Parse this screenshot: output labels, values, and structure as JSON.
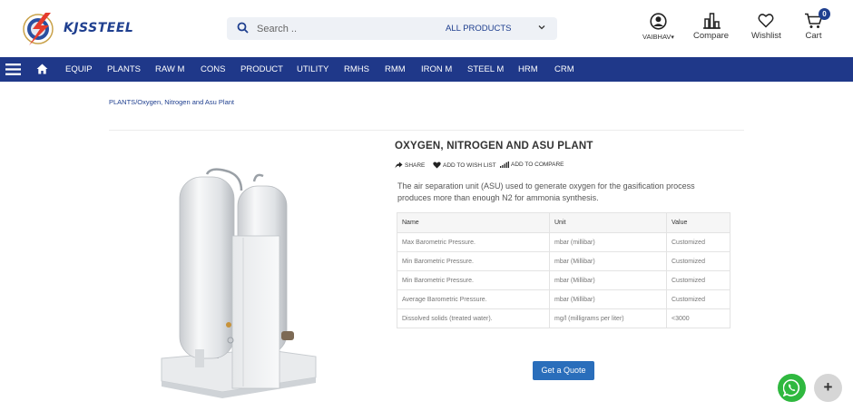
{
  "brand": {
    "name": "KJSSTEEL"
  },
  "search": {
    "placeholder": "Search ..",
    "category": "ALL PRODUCTS"
  },
  "header": {
    "user_label": "VAIBHAV",
    "compare_label": "Compare",
    "wishlist_label": "Wishlist",
    "cart_label": "Cart",
    "cart_count": "0"
  },
  "nav": {
    "items": [
      "EQUIP",
      "PLANTS",
      "RAW M",
      "CONS",
      "PRODUCT",
      "UTILITY",
      "RMHS",
      "RMM",
      "IRON M",
      "STEEL M",
      "HRM",
      "CRM"
    ]
  },
  "breadcrumb": {
    "root": "PLANTS",
    "separator": "/",
    "current": "Oxygen, Nitrogen and Asu Plant"
  },
  "product": {
    "title": "OXYGEN, NITROGEN AND ASU PLANT",
    "share_label": "SHARE",
    "wishlist_label": "ADD TO WISH LIST",
    "compare_label": "ADD TO COMPARE",
    "description": "The air separation unit (ASU) used to generate oxygen for the gasification process produces more than enough N2 for ammonia synthesis.",
    "table": {
      "headers": [
        "Name",
        "Unit",
        "Value"
      ],
      "rows": [
        [
          "Max Barometric Pressure.",
          "mbar (millibar)",
          "Customized"
        ],
        [
          "Min Barometric Pressure.",
          "mbar (Millibar)",
          "Customized"
        ],
        [
          "Min Barometric Pressure.",
          "mbar (Millibar)",
          "Customized"
        ],
        [
          "Average Barometric Pressure.",
          "mbar (Millibar)",
          "Customized"
        ],
        [
          "Dissolved solids (treated water).",
          "mg/l (milligrams per liter)",
          "<3000"
        ]
      ]
    },
    "quote_label": "Get a Quote"
  },
  "floating": {
    "plus_label": "+"
  },
  "colors": {
    "nav_bg": "#1f3889",
    "accent": "#2a6ebb",
    "whatsapp": "#2fb83f"
  }
}
